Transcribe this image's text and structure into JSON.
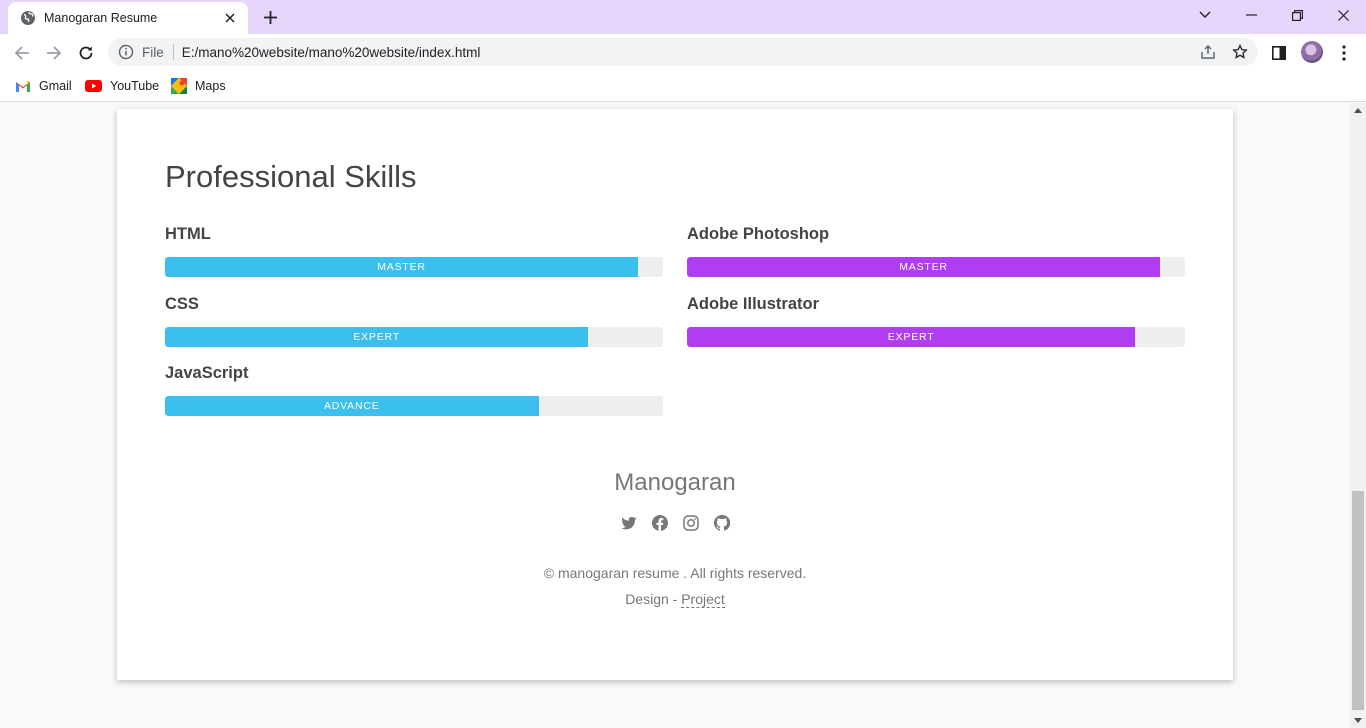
{
  "browser": {
    "tab_title": "Manogaran Resume",
    "address_scheme": "File",
    "address_url": "E:/mano%20website/mano%20website/index.html",
    "bookmarks": [
      {
        "label": "Gmail",
        "icon": "gmail-icon"
      },
      {
        "label": "YouTube",
        "icon": "youtube-icon"
      },
      {
        "label": "Maps",
        "icon": "maps-icon"
      }
    ]
  },
  "page": {
    "section_title": "Professional Skills",
    "skills": [
      {
        "name": "HTML",
        "level": "MASTER",
        "percent": 95,
        "color": "#3bbfec"
      },
      {
        "name": "Adobe Photoshop",
        "level": "MASTER",
        "percent": 95,
        "color": "#b03ef0"
      },
      {
        "name": "CSS",
        "level": "EXPERT",
        "percent": 85,
        "color": "#3bbfec"
      },
      {
        "name": "Adobe Illustrator",
        "level": "EXPERT",
        "percent": 90,
        "color": "#b03ef0"
      },
      {
        "name": "JavaScript",
        "level": "ADVANCE",
        "percent": 75,
        "color": "#3bbfec"
      }
    ],
    "footer": {
      "name": "Manogaran",
      "social_icons": [
        "twitter-icon",
        "facebook-icon",
        "instagram-icon",
        "github-icon"
      ],
      "copyright": "© manogaran resume . All rights reserved.",
      "design_prefix": "Design - ",
      "design_link": "Project"
    }
  }
}
